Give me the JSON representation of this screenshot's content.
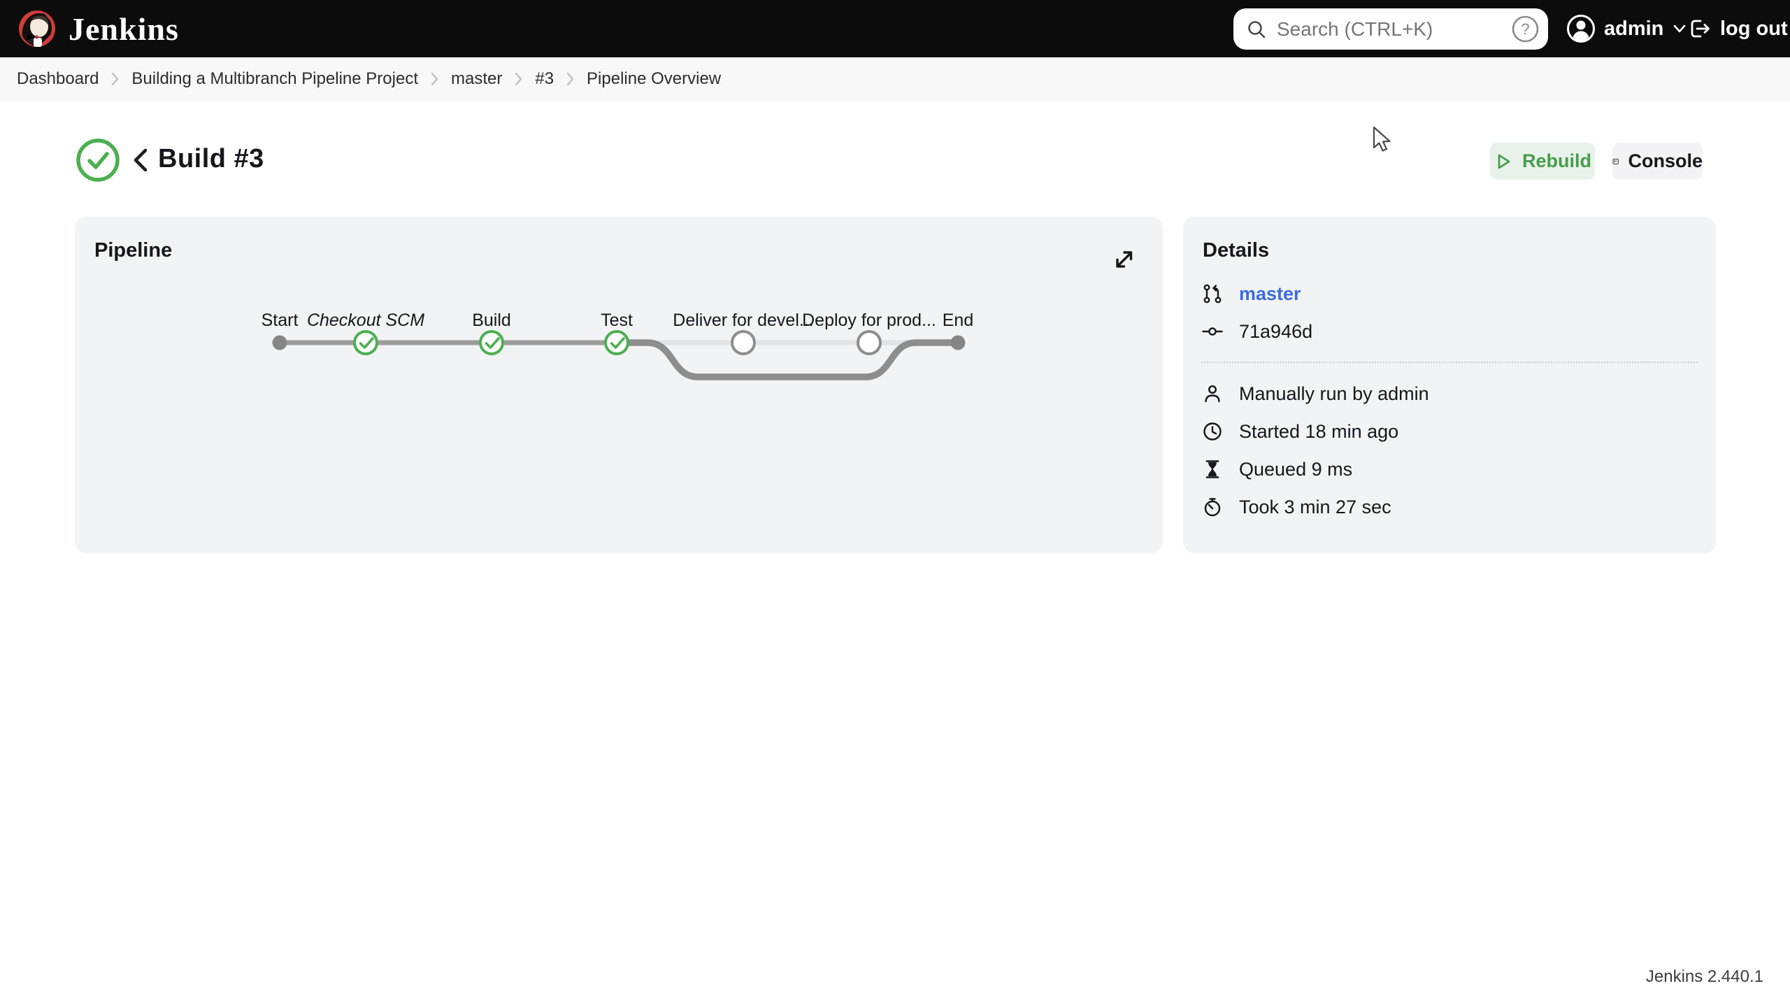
{
  "navbar": {
    "brand": "Jenkins",
    "search_placeholder": "Search (CTRL+K)",
    "user": "admin",
    "logout": "log out"
  },
  "breadcrumb": {
    "items": [
      "Dashboard",
      "Building a Multibranch Pipeline Project",
      "master",
      "#3",
      "Pipeline Overview"
    ]
  },
  "header": {
    "title": "Build #3",
    "status": "success",
    "rebuild": "Rebuild",
    "console": "Console"
  },
  "pipeline": {
    "title": "Pipeline",
    "stages": [
      {
        "name": "Start",
        "status": "terminal"
      },
      {
        "name": "Checkout SCM",
        "status": "success"
      },
      {
        "name": "Build",
        "status": "success"
      },
      {
        "name": "Test",
        "status": "success"
      },
      {
        "name": "Deliver for devel...",
        "status": "skipped"
      },
      {
        "name": "Deploy for prod...",
        "status": "skipped"
      },
      {
        "name": "End",
        "status": "terminal"
      }
    ]
  },
  "details": {
    "title": "Details",
    "branch": "master",
    "commit": "71a946d",
    "rows": [
      {
        "icon": "user-icon",
        "text": "Manually run by admin"
      },
      {
        "icon": "clock-icon",
        "text": "Started 18 min ago"
      },
      {
        "icon": "hourglass-icon",
        "text": "Queued 9 ms"
      },
      {
        "icon": "stopwatch-icon",
        "text": "Took 3 min 27 sec"
      }
    ]
  },
  "footer": {
    "version": "Jenkins 2.440.1"
  },
  "colors": {
    "navbar_bg": "#0c0c0c",
    "breadcrumb_bg": "#f8f8f8",
    "card_bg": "#f2f3f5",
    "success_green": "#4caf50",
    "rebuild_bg": "#e9f2ea",
    "rebuild_text": "#479d4e",
    "link_blue": "#3b6ddf",
    "line_gray": "#9c9c9c",
    "skipped_gray": "#e2e3e5",
    "logo_red": "#cf3d3b"
  },
  "icons": [
    "jenkins-butler",
    "search",
    "help-circle",
    "user-avatar",
    "chevron-down",
    "log-out",
    "breadcrumb-chevron",
    "success-check",
    "back-chevron",
    "play",
    "terminal",
    "expand",
    "git-branch",
    "commit",
    "user",
    "clock",
    "hourglass",
    "stopwatch",
    "mouse-cursor"
  ]
}
